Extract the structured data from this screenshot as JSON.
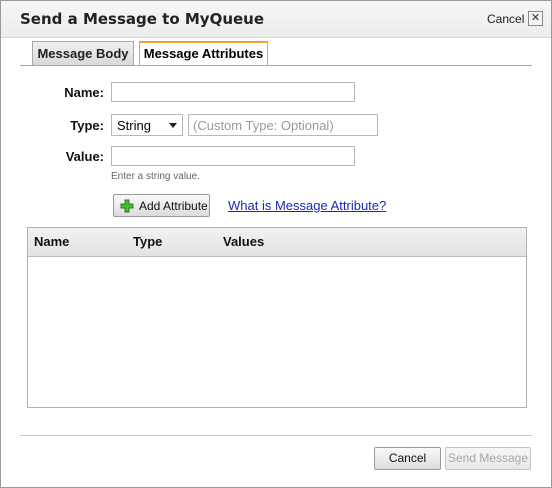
{
  "dialog": {
    "title": "Send a Message to MyQueue",
    "cancel_link": "Cancel",
    "close_glyph": "✕"
  },
  "tabs": [
    {
      "label": "Message Body",
      "active": false
    },
    {
      "label": "Message Attributes",
      "active": true
    }
  ],
  "form": {
    "name_label": "Name:",
    "name_value": "",
    "type_label": "Type:",
    "type_selected": "String",
    "custom_type_placeholder": "(Custom Type: Optional)",
    "value_label": "Value:",
    "value_value": "",
    "value_hint": "Enter a string value.",
    "add_button_label": "Add Attribute",
    "help_link": "What is Message Attribute?"
  },
  "table": {
    "columns": [
      "Name",
      "Type",
      "Values"
    ],
    "rows": []
  },
  "footer": {
    "cancel_label": "Cancel",
    "send_label": "Send Message",
    "send_enabled": false
  },
  "colors": {
    "active_tab_accent": "#f0a030",
    "link": "#1a27b8",
    "add_icon": "#3a9a2a"
  },
  "icons": {
    "add": "plus-icon",
    "close": "close-icon",
    "dropdown": "chevron-down-icon"
  }
}
